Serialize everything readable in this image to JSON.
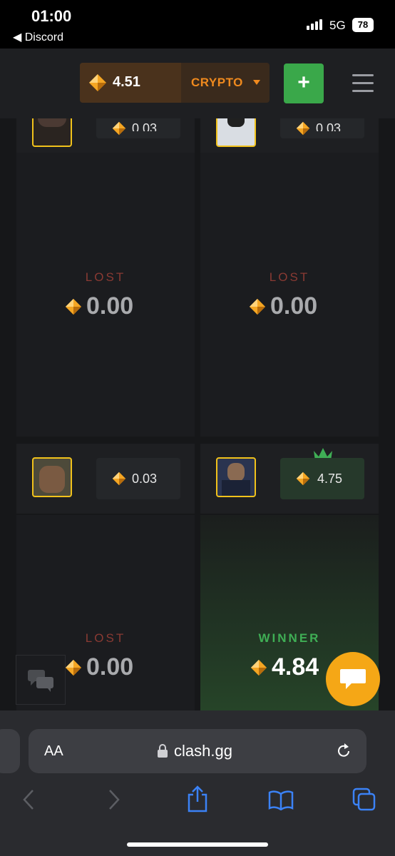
{
  "status_bar": {
    "time": "01:00",
    "back_label": "◀ Discord",
    "network": "5G",
    "battery": "78"
  },
  "header": {
    "balance": "4.51",
    "currency": "CRYPTO",
    "deposit_label": "+"
  },
  "players": [
    {
      "bet": "0.03",
      "status": "LOST",
      "amount": "0.00"
    },
    {
      "bet": "0.03",
      "status": "LOST",
      "amount": "0.00"
    },
    {
      "bet": "0.03",
      "status": "LOST",
      "amount": "0.00"
    },
    {
      "bet": "4.75",
      "status": "WINNER",
      "amount": "4.84"
    }
  ],
  "browser": {
    "aa_label": "AA",
    "domain": "clash.gg"
  },
  "colors": {
    "accent_orange": "#f08a1e",
    "gem": "#f5a623",
    "win_green": "#3fae55",
    "lost_red": "#8a3a33",
    "avatar_border": "#f1c21b"
  }
}
